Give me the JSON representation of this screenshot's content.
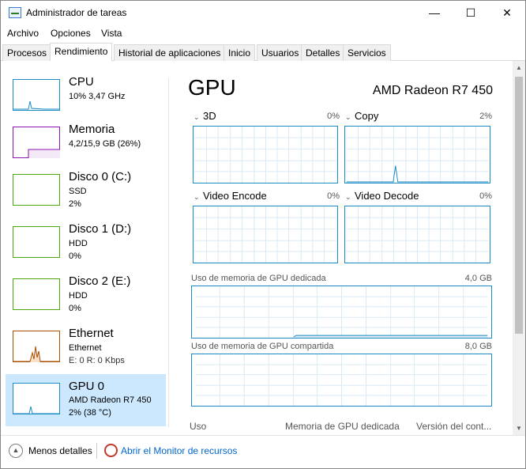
{
  "window": {
    "title": "Administrador de tareas",
    "minimize": "—",
    "maximize": "☐",
    "close": "✕"
  },
  "menu": [
    "Archivo",
    "Opciones",
    "Vista"
  ],
  "tabs": [
    "Procesos",
    "Rendimiento",
    "Historial de aplicaciones",
    "Inicio",
    "Usuarios",
    "Detalles",
    "Servicios"
  ],
  "active_tab": "Rendimiento",
  "sidebar": {
    "items": [
      {
        "name": "CPU",
        "line1": "10% 3,47 GHz",
        "line2": ""
      },
      {
        "name": "Memoria",
        "line1": "4,2/15,9 GB (26%)",
        "line2": ""
      },
      {
        "name": "Disco 0 (C:)",
        "line1": "SSD",
        "line2": "2%"
      },
      {
        "name": "Disco 1 (D:)",
        "line1": "HDD",
        "line2": "0%"
      },
      {
        "name": "Disco 2 (E:)",
        "line1": "HDD",
        "line2": "0%"
      },
      {
        "name": "Ethernet",
        "line1": "Ethernet",
        "line2": "E: 0 R: 0 Kbps"
      },
      {
        "name": "GPU 0",
        "line1": "AMD Radeon R7 450",
        "line2": "2% (38 °C)"
      }
    ],
    "selected": "GPU 0"
  },
  "main": {
    "title": "GPU",
    "model": "AMD Radeon R7 450",
    "engines": [
      {
        "label": "3D",
        "pct": "0%"
      },
      {
        "label": "Copy",
        "pct": "2%"
      },
      {
        "label": "Video Encode",
        "pct": "0%"
      },
      {
        "label": "Video Decode",
        "pct": "0%"
      }
    ],
    "dedicated": {
      "label": "Uso de memoria de GPU dedicada",
      "value": "4,0 GB"
    },
    "shared": {
      "label": "Uso de memoria de GPU compartida",
      "value": "8,0 GB"
    },
    "footer": [
      "Uso",
      "Memoria de GPU dedicada",
      "Versión del cont..."
    ]
  },
  "bottom": {
    "fewer_details": "Menos detalles",
    "resource_monitor": "Abrir el Monitor de recursos"
  },
  "colors": {
    "gpu_line": "#1b8bc3",
    "cpu_line": "#1b8bc3",
    "memory_line": "#8b12ae",
    "disk_line": "#4da60c",
    "ethernet_line": "#a74f01",
    "selected_bg": "#cce8ff"
  }
}
